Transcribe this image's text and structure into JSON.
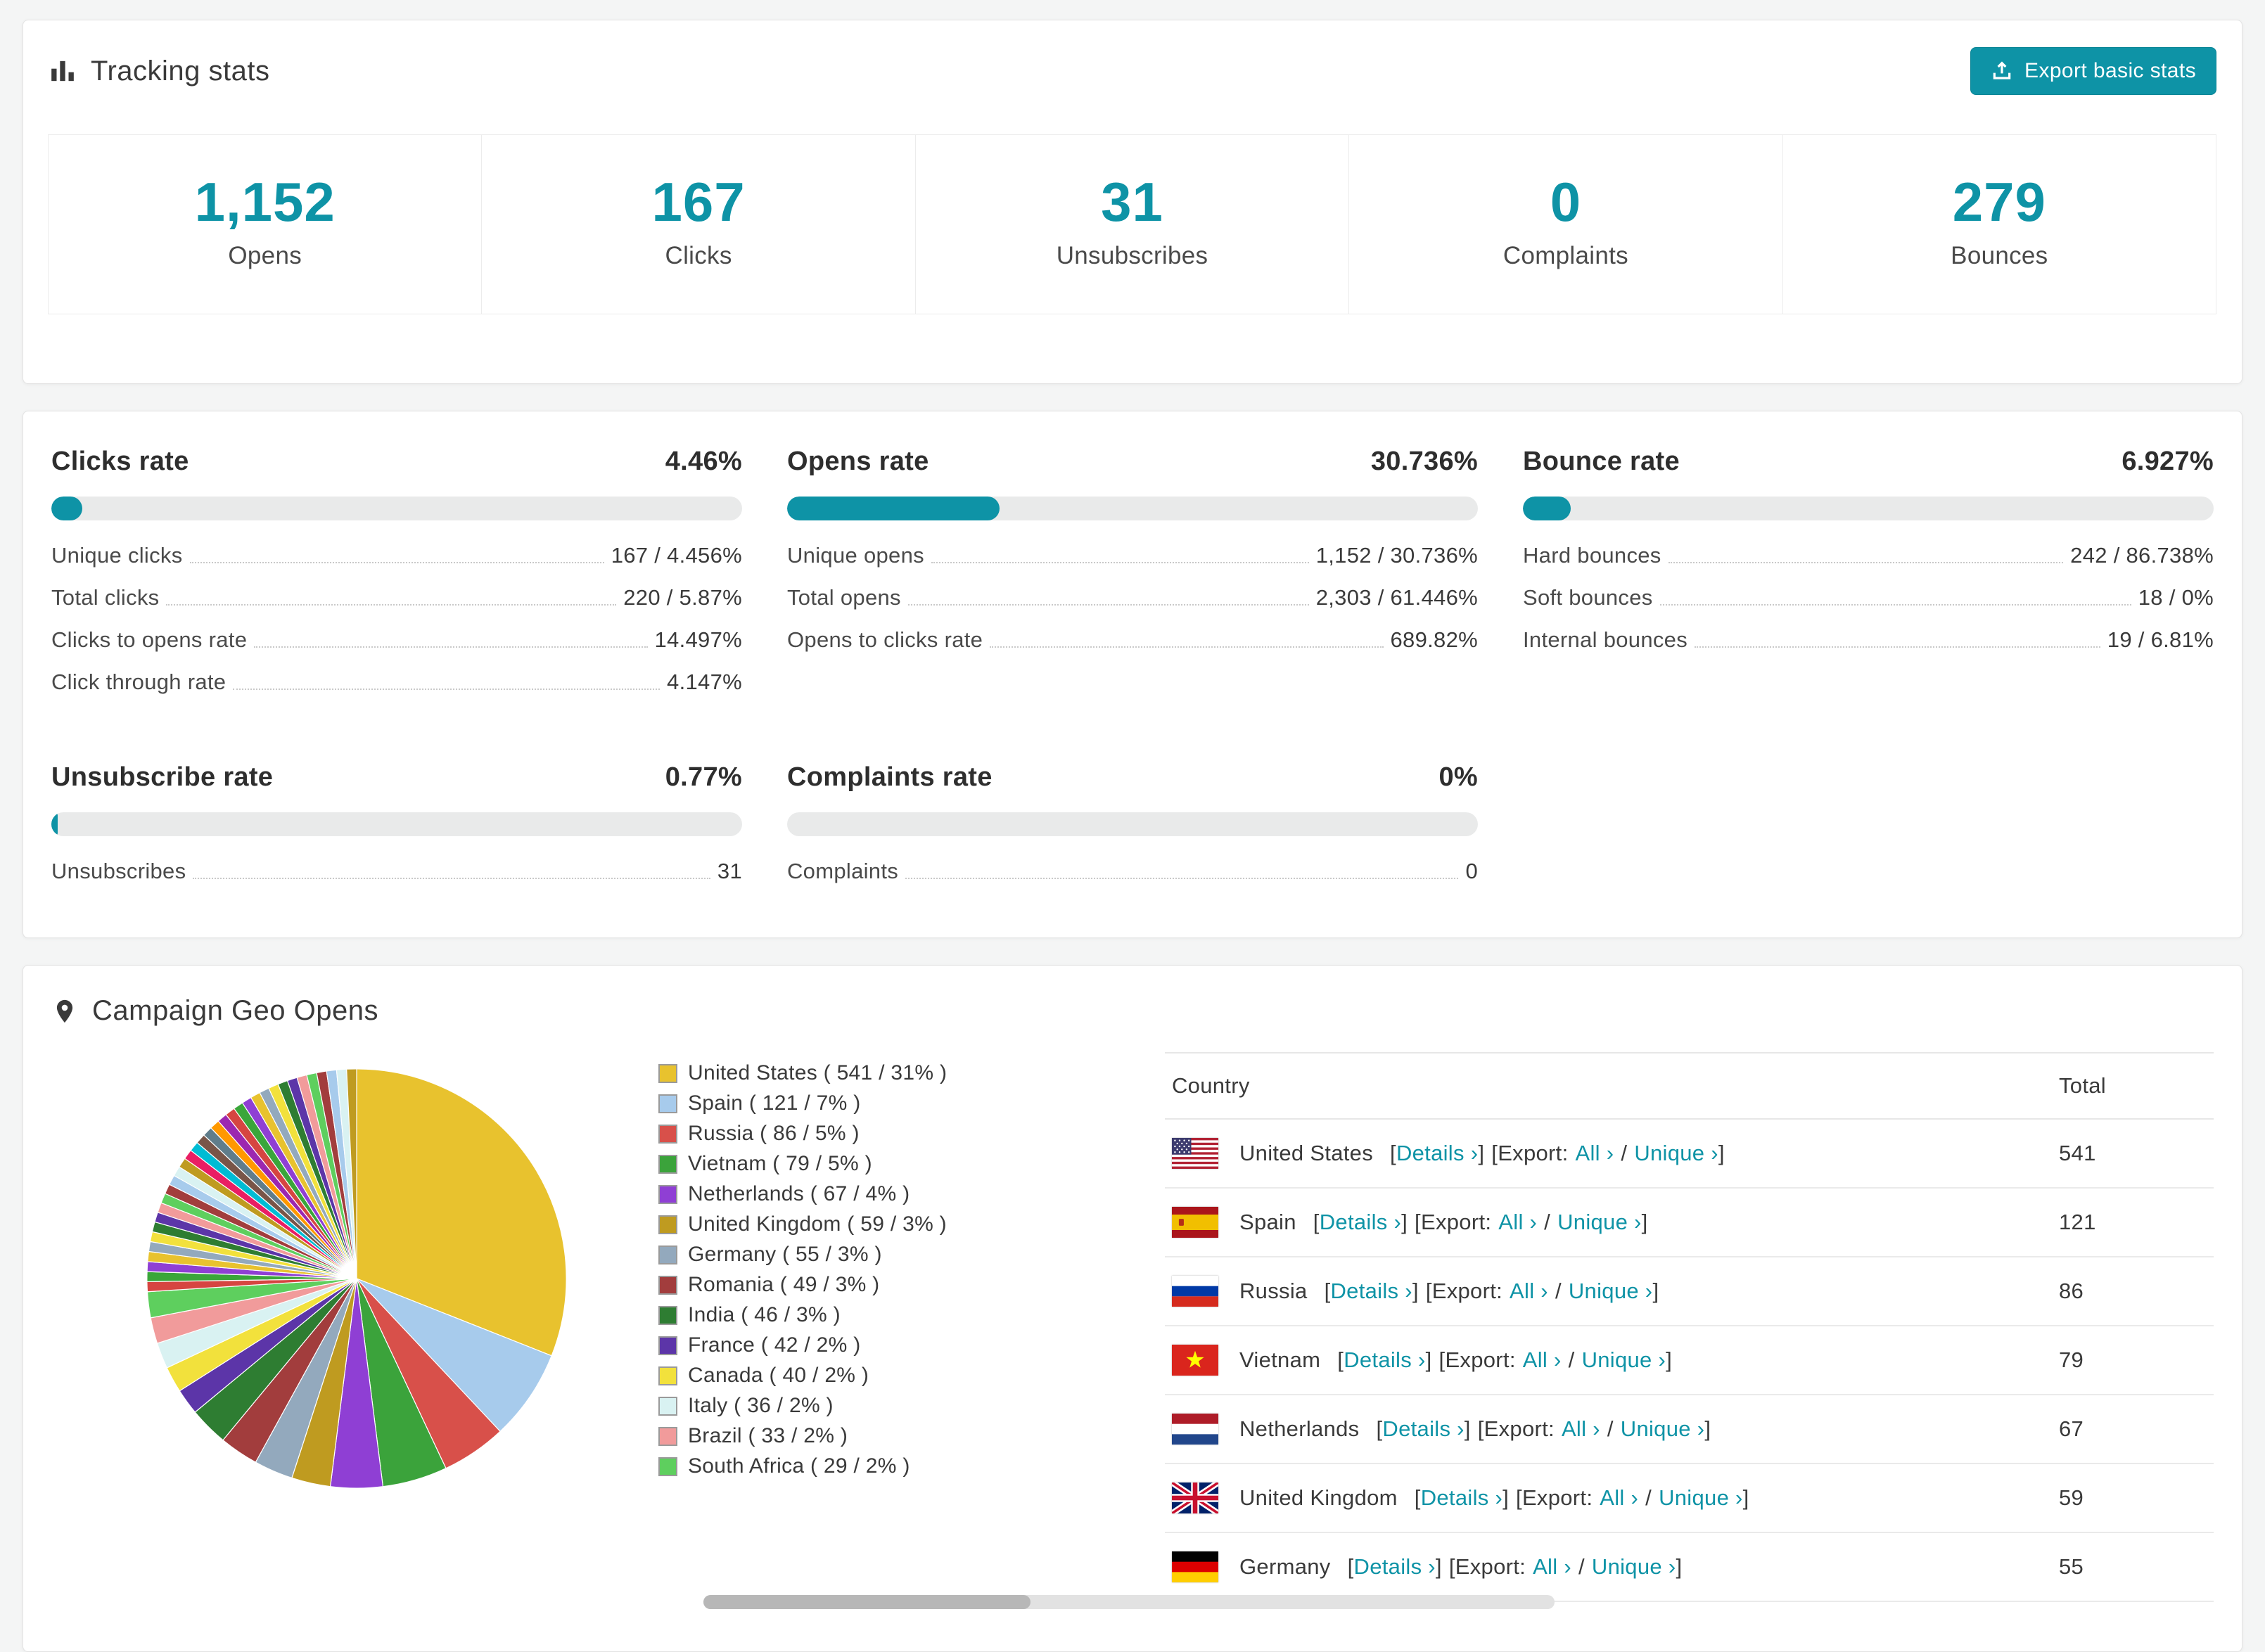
{
  "accent_color": "#0e93a6",
  "tracking": {
    "title": "Tracking stats",
    "export_button": "Export basic stats",
    "counters": [
      {
        "value": "1,152",
        "label": "Opens"
      },
      {
        "value": "167",
        "label": "Clicks"
      },
      {
        "value": "31",
        "label": "Unsubscribes"
      },
      {
        "value": "0",
        "label": "Complaints"
      },
      {
        "value": "279",
        "label": "Bounces"
      }
    ]
  },
  "rates": [
    {
      "title": "Clicks rate",
      "value": "4.46%",
      "percent": 4.46,
      "rows": [
        {
          "label": "Unique clicks",
          "value": "167 / 4.456%"
        },
        {
          "label": "Total clicks",
          "value": "220 / 5.87%"
        },
        {
          "label": "Clicks to opens rate",
          "value": "14.497%"
        },
        {
          "label": "Click through rate",
          "value": "4.147%"
        }
      ]
    },
    {
      "title": "Opens rate",
      "value": "30.736%",
      "percent": 30.736,
      "rows": [
        {
          "label": "Unique opens",
          "value": "1,152 / 30.736%"
        },
        {
          "label": "Total opens",
          "value": "2,303 / 61.446%"
        },
        {
          "label": "Opens to clicks rate",
          "value": "689.82%"
        }
      ]
    },
    {
      "title": "Bounce rate",
      "value": "6.927%",
      "percent": 6.927,
      "rows": [
        {
          "label": "Hard bounces",
          "value": "242 / 86.738%"
        },
        {
          "label": "Soft bounces",
          "value": "18 / 0%"
        },
        {
          "label": "Internal bounces",
          "value": "19 / 6.81%"
        }
      ]
    },
    {
      "title": "Unsubscribe rate",
      "value": "0.77%",
      "percent": 0.77,
      "rows": [
        {
          "label": "Unsubscribes",
          "value": "31"
        }
      ]
    },
    {
      "title": "Complaints rate",
      "value": "0%",
      "percent": 0,
      "rows": [
        {
          "label": "Complaints",
          "value": "0"
        }
      ]
    }
  ],
  "geo": {
    "title": "Campaign Geo Opens",
    "table": {
      "headers": {
        "country": "Country",
        "total": "Total"
      },
      "lbracket": "[",
      "rbracket": "]",
      "details_label": "Details ›",
      "export_label": "Export:",
      "all_label": "All ›",
      "slash": "/",
      "unique_label": "Unique ›",
      "rows": [
        {
          "flag": "us",
          "country": "United States",
          "total": "541"
        },
        {
          "flag": "es",
          "country": "Spain",
          "total": "121"
        },
        {
          "flag": "ru",
          "country": "Russia",
          "total": "86"
        },
        {
          "flag": "vn",
          "country": "Vietnam",
          "total": "79"
        },
        {
          "flag": "nl",
          "country": "Netherlands",
          "total": "67"
        },
        {
          "flag": "gb",
          "country": "United Kingdom",
          "total": "59"
        },
        {
          "flag": "de",
          "country": "Germany",
          "total": "55"
        }
      ]
    }
  },
  "chart_data": {
    "type": "pie",
    "title": "Campaign Geo Opens",
    "start_angle_deg": -90,
    "direction": "clockwise",
    "legend_position": "right",
    "series": [
      {
        "label": "United States",
        "value": 541,
        "percent": 31,
        "color": "#e8c22e"
      },
      {
        "label": "Spain",
        "value": 121,
        "percent": 7,
        "color": "#a7cbec"
      },
      {
        "label": "Russia",
        "value": 86,
        "percent": 5,
        "color": "#d8504a"
      },
      {
        "label": "Vietnam",
        "value": 79,
        "percent": 5,
        "color": "#3ba33b"
      },
      {
        "label": "Netherlands",
        "value": 67,
        "percent": 4,
        "color": "#8f3fd4"
      },
      {
        "label": "United Kingdom",
        "value": 59,
        "percent": 3,
        "color": "#bf9b20"
      },
      {
        "label": "Germany",
        "value": 55,
        "percent": 3,
        "color": "#93a9bd"
      },
      {
        "label": "Romania",
        "value": 49,
        "percent": 3,
        "color": "#a23d3d"
      },
      {
        "label": "India",
        "value": 46,
        "percent": 3,
        "color": "#2e7d32"
      },
      {
        "label": "France",
        "value": 42,
        "percent": 2,
        "color": "#5c35a8"
      },
      {
        "label": "Canada",
        "value": 40,
        "percent": 2,
        "color": "#f2e13c"
      },
      {
        "label": "Italy",
        "value": 36,
        "percent": 2,
        "color": "#d9f2f2"
      },
      {
        "label": "Brazil",
        "value": 33,
        "percent": 2,
        "color": "#f19b9b"
      },
      {
        "label": "South Africa",
        "value": 29,
        "percent": 2,
        "color": "#5ecf5e"
      }
    ],
    "other_slices": {
      "approx_count": 34,
      "total_percent": 26,
      "palette": [
        "#d64541",
        "#3aa63a",
        "#8f3fd4",
        "#e8c22e",
        "#93a9bd",
        "#f2e13c",
        "#2e7d32",
        "#5c35a8",
        "#f19b9b",
        "#5ecf5e",
        "#a23d3d",
        "#a7cbec",
        "#d9f2f2",
        "#bf9b20",
        "#e91e63",
        "#00bcd4",
        "#795548",
        "#607d8b",
        "#ff9800",
        "#9c27b0"
      ]
    }
  }
}
